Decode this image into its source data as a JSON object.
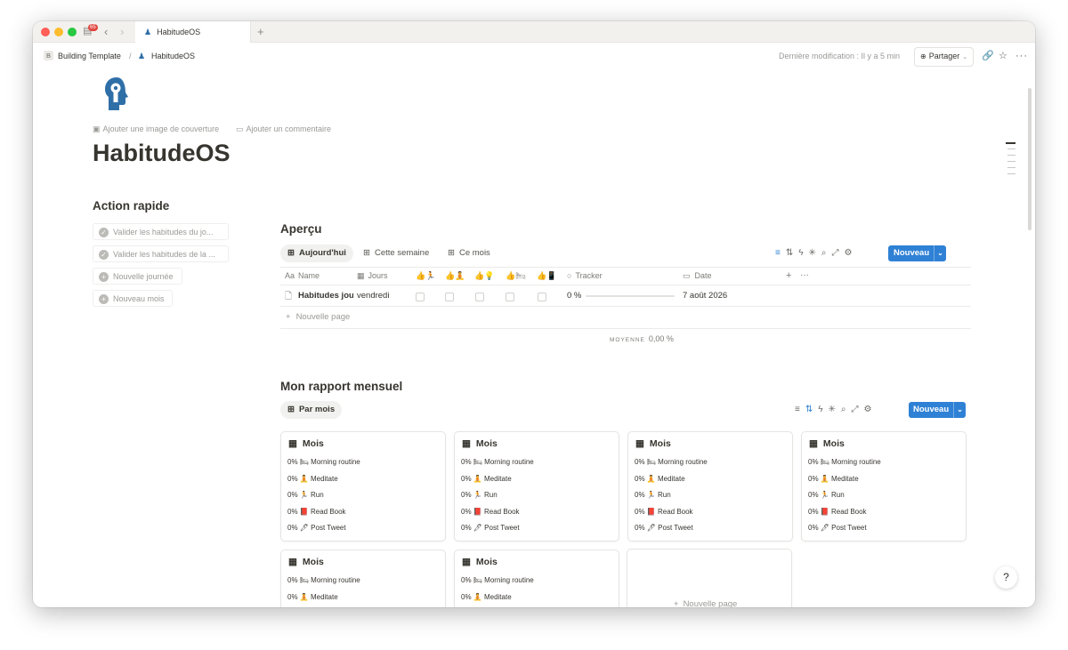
{
  "window": {
    "tab_title": "HabitudeOS",
    "badge_count": "65",
    "new_tab": "+"
  },
  "topbar": {
    "workspace_initial": "B",
    "workspace_name": "Building Template",
    "separator": "/",
    "page_name": "HabitudeOS",
    "last_modified": "Dernière modification : Il y a 5 min",
    "share_label": "Partager"
  },
  "page": {
    "add_cover": "Ajouter une image de couverture",
    "add_comment": "Ajouter un commentaire",
    "title": "HabitudeOS"
  },
  "quick_actions": {
    "title": "Action rapide",
    "items": [
      {
        "label": "Valider les habitudes du jo...",
        "icon": "check-circle-icon"
      },
      {
        "label": "Valider les habitudes de la ...",
        "icon": "check-circle-icon"
      },
      {
        "label": "Nouvelle journée",
        "icon": "plus-circle-icon"
      },
      {
        "label": "Nouveau mois",
        "icon": "plus-circle-icon"
      }
    ]
  },
  "apercu": {
    "title": "Aperçu",
    "tabs": [
      "Aujourd'hui",
      "Cette semaine",
      "Ce mois"
    ],
    "new_button": "Nouveau",
    "columns": {
      "name": "Name",
      "jours": "Jours",
      "tracker": "Tracker",
      "date": "Date"
    },
    "habit_emojis": [
      "🏃",
      "🧘",
      "💡",
      "🛏",
      "📱"
    ],
    "row": {
      "name": "Habitudes jour",
      "jour": "vendredi",
      "tracker": "0 %",
      "date": "7 août 2026"
    },
    "new_page": "Nouvelle page",
    "average_label": "MOYENNE",
    "average_value": "0,00 %"
  },
  "rapport": {
    "title": "Mon rapport mensuel",
    "view_tab": "Par mois",
    "new_button": "Nouveau",
    "new_page": "Nouvelle page",
    "cards": [
      {
        "title": "Mois",
        "lines": [
          "0% 🛏 Morning routine",
          "0% 🧘 Meditate",
          "0% 🏃 Run",
          "0% 📕 Read Book",
          "0% 🖊 Post Tweet"
        ]
      },
      {
        "title": "Mois",
        "lines": [
          "0% 🛏 Morning routine",
          "0% 🧘 Meditate",
          "0% 🏃 Run",
          "0% 📕 Read Book",
          "0% 🖊 Post Tweet"
        ]
      },
      {
        "title": "Mois",
        "lines": [
          "0% 🛏 Morning routine",
          "0% 🧘 Meditate",
          "0% 🏃 Run",
          "0% 📕 Read Book",
          "0% 🖊 Post Tweet"
        ]
      },
      {
        "title": "Mois",
        "lines": [
          "0% 🛏 Morning routine",
          "0% 🧘 Meditate",
          "0% 🏃 Run",
          "0% 📕 Read Book",
          "0% 🖊 Post Tweet"
        ]
      },
      {
        "title": "Mois",
        "lines": [
          "0% 🛏 Morning routine",
          "0% 🧘 Meditate"
        ]
      },
      {
        "title": "Mois",
        "lines": [
          "0% 🛏 Morning routine",
          "0% 🧘 Meditate"
        ]
      }
    ]
  },
  "colors": {
    "accent": "#2f81d5",
    "logo": "#2f6fa8",
    "badge": "#e0463e"
  }
}
